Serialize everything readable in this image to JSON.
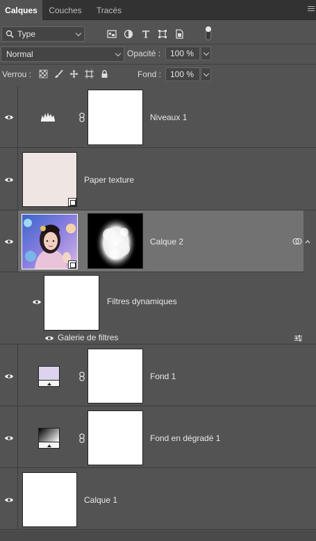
{
  "tabs": [
    {
      "label": "Calques",
      "active": true
    },
    {
      "label": "Couches",
      "active": false
    },
    {
      "label": "Tracés",
      "active": false
    }
  ],
  "filter": {
    "kind_label": "Type",
    "icons": [
      "pixel-filter-icon",
      "adjustment-filter-icon",
      "type-filter-icon",
      "shape-filter-icon",
      "smart-object-filter-icon"
    ]
  },
  "blend": {
    "mode": "Normal",
    "opacity_label": "Opacité :",
    "opacity_value": "100 %"
  },
  "lock": {
    "label": "Verrou :",
    "fill_label": "Fond :",
    "fill_value": "100 %",
    "icons": [
      "lock-transparent-icon",
      "lock-paint-icon",
      "lock-move-icon",
      "lock-artboard-icon",
      "lock-all-icon"
    ]
  },
  "layers": [
    {
      "name": "Niveaux 1",
      "kind": "adjustment-levels",
      "visible": true,
      "selected": false
    },
    {
      "name": "Paper texture",
      "kind": "smart-object",
      "visible": true,
      "selected": false
    },
    {
      "name": "Calque 2",
      "kind": "smart-object-masked",
      "visible": true,
      "selected": true
    },
    {
      "name": "Filtres dynamiques",
      "kind": "smart-filters",
      "visible": true,
      "selected": false
    },
    {
      "name": "Galerie de filtres",
      "kind": "filter-entry",
      "visible": true,
      "selected": false
    },
    {
      "name": "Fond 1",
      "kind": "fill-solid",
      "visible": true,
      "selected": false
    },
    {
      "name": "Fond en dégradé 1",
      "kind": "fill-gradient",
      "visible": true,
      "selected": false
    },
    {
      "name": "Calque 1",
      "kind": "pixel",
      "visible": true,
      "selected": false
    }
  ],
  "colors": {
    "paper_texture": "#efe6e3",
    "fond1_swatch": "#ddd3ee",
    "panel_bg": "#535353",
    "selected_bg": "#727272"
  }
}
